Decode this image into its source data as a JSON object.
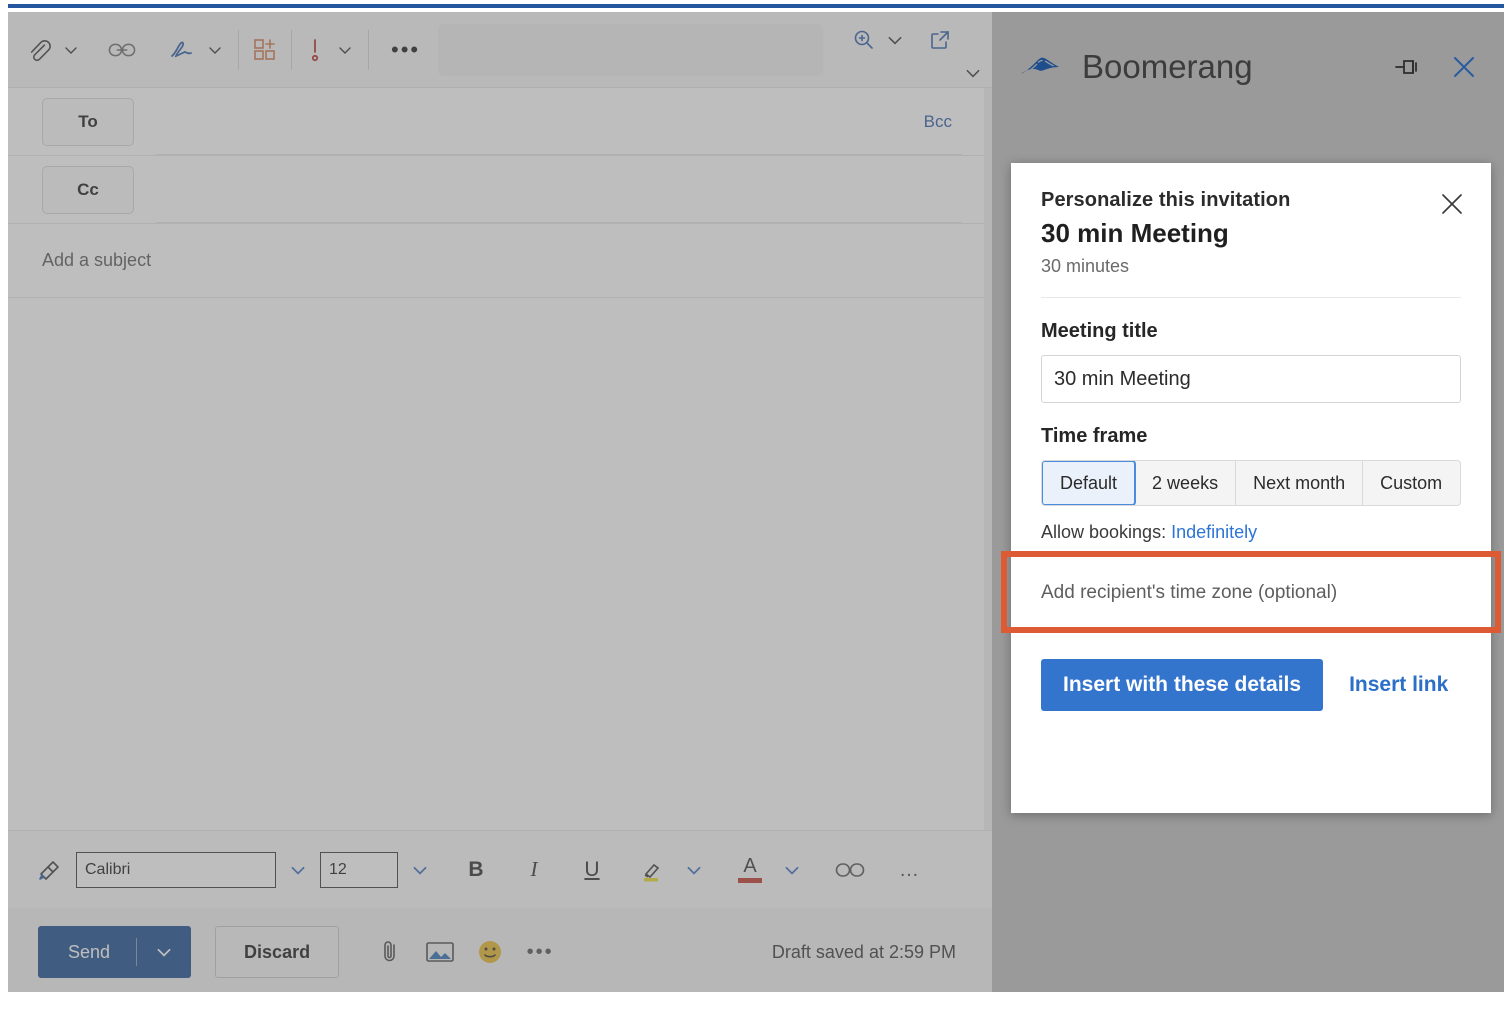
{
  "window": {
    "accent_top_color": "#2457a0"
  },
  "compose": {
    "toolbar": {
      "icons": [
        {
          "name": "attach-icon",
          "glyph": "paperclip"
        },
        {
          "name": "attach-chevron-icon",
          "glyph": "chevron-down"
        },
        {
          "name": "link-icon",
          "glyph": "link"
        },
        {
          "name": "signature-icon",
          "glyph": "signature"
        },
        {
          "name": "signature-chevron-icon",
          "glyph": "chevron-down"
        },
        {
          "name": "apps-add-icon",
          "glyph": "apps-plus"
        },
        {
          "name": "importance-icon",
          "glyph": "exclamation"
        },
        {
          "name": "importance-chevron-icon",
          "glyph": "chevron-down"
        },
        {
          "name": "more-commands-icon",
          "glyph": "ellipsis"
        }
      ],
      "zoom_label": "Zoom",
      "popout_label": "Open in new window"
    },
    "fields": {
      "to_label": "To",
      "cc_label": "Cc",
      "bcc_label": "Bcc",
      "subject_placeholder": "Add a subject"
    },
    "format_toolbar": {
      "font_name": "Calibri",
      "font_size": "12",
      "bold_label": "B",
      "italic_label": "I",
      "underline_label": "U",
      "font_color_label": "A",
      "more_label": "…"
    },
    "send_bar": {
      "send_label": "Send",
      "discard_label": "Discard",
      "draft_status": "Draft saved at 2:59 PM"
    }
  },
  "panel": {
    "brand_name": "Boomerang",
    "pin_label": "Pin",
    "close_label": "Close",
    "card": {
      "eyebrow": "Personalize this invitation",
      "title": "30 min Meeting",
      "subtitle": "30 minutes",
      "close_label": "Close",
      "meeting_title_label": "Meeting title",
      "meeting_title_value": "30 min Meeting",
      "time_frame_label": "Time frame",
      "time_frame_options": [
        {
          "label": "Default",
          "selected": true
        },
        {
          "label": "2 weeks",
          "selected": false
        },
        {
          "label": "Next month",
          "selected": false
        },
        {
          "label": "Custom",
          "selected": false
        }
      ],
      "allow_bookings_prefix": "Allow bookings: ",
      "allow_bookings_value": "Indefinitely",
      "timezone_placeholder": "Add recipient's time zone (optional)",
      "timezone_highlight_color": "#dc5b34",
      "primary_button": "Insert with these details",
      "secondary_link": "Insert link"
    }
  },
  "colors": {
    "accent_blue": "#3374cd",
    "send_blue": "#1b4f91",
    "link_blue": "#2c6fc9",
    "highlight_orange": "#dc5b34",
    "panel_gray": "#9a9a9a"
  }
}
